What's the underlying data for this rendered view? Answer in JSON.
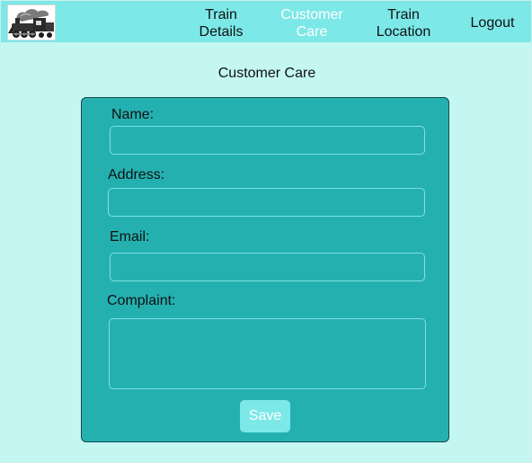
{
  "navbar": {
    "items": [
      {
        "line1": "Train",
        "line2": "Details"
      },
      {
        "line1": "Customer",
        "line2": "Care"
      },
      {
        "line1": "Train",
        "line2": "Location"
      }
    ],
    "logout": "Logout",
    "logo_icon": "train-icon"
  },
  "page": {
    "title": "Customer Care"
  },
  "form": {
    "name_label": "Name:",
    "address_label": "Address:",
    "email_label": "Email:",
    "complaint_label": "Complaint:",
    "name_value": "",
    "address_value": "",
    "email_value": "",
    "complaint_value": "",
    "save_label": "Save"
  },
  "colors": {
    "navbar": "#7de8e8",
    "background": "#c4f6f2",
    "card": "#25b0b0",
    "card_border": "#16484a",
    "field_border": "#7fe0e0",
    "active_nav_text": "#ffffff",
    "save_button": "#7de8e8"
  }
}
